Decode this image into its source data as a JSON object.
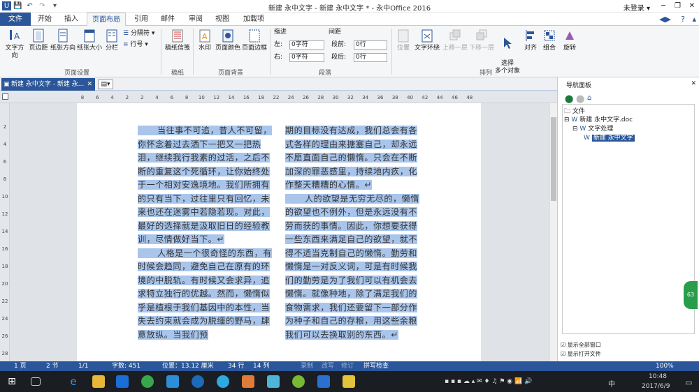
{
  "titlebar": {
    "title": "新建 永中文字 - 新建 永中文字 * - 永中Office 2016",
    "login": "未登录 ▾",
    "min": "─",
    "restore": "❐",
    "close": "✕"
  },
  "tabs": [
    {
      "label": "文件"
    },
    {
      "label": "开始"
    },
    {
      "label": "插入"
    },
    {
      "label": "页面布局"
    },
    {
      "label": "引用"
    },
    {
      "label": "邮件"
    },
    {
      "label": "审阅"
    },
    {
      "label": "视图"
    },
    {
      "label": "加载项"
    }
  ],
  "ribbon": {
    "page_setup": {
      "text_direction": "文字方向",
      "margins": "页边距",
      "orientation": "纸张方向",
      "size": "纸张大小",
      "columns": "分栏",
      "breaks": "分隔符 ▾",
      "line_numbers": "行号 ▾",
      "group": "页面设置"
    },
    "paper": {
      "manuscript": "稿纸信笺",
      "group": "稿纸"
    },
    "background": {
      "watermark": "水印",
      "page_color": "页面颜色",
      "page_border": "页面边框",
      "group": "页面背景"
    },
    "paragraph": {
      "indent": "缩进",
      "spacing": "间距",
      "left_label": "左:",
      "left_value": "0字符",
      "right_label": "右:",
      "right_value": "0字符",
      "before_label": "段前:",
      "before_value": "0行",
      "after_label": "段后:",
      "after_value": "0行",
      "group": "段落"
    },
    "arrange": {
      "position": "位置",
      "wrap": "文字环绕",
      "bring_forward": "上移一层",
      "send_backward": "下移一层",
      "select_objects": "选择\n多个对象",
      "align": "对齐",
      "group_btn": "组合",
      "rotate": "旋转",
      "group": "排列"
    }
  },
  "doctab": {
    "label": "新建 永中文字 - 新建 永...",
    "close": "✕"
  },
  "ruler": {
    "ticks": [
      "8",
      "6",
      "4",
      "2",
      "2",
      "4",
      "6",
      "8",
      "10",
      "12",
      "14",
      "16",
      "18",
      "22",
      "24",
      "26",
      "28",
      "30",
      "32",
      "34",
      "36",
      "38",
      "40",
      "42",
      "44",
      "46",
      "48"
    ]
  },
  "vruler": {
    "ticks": [
      "2",
      "4",
      "6",
      "8",
      "10",
      "12",
      "14",
      "16",
      "18",
      "20",
      "22",
      "24",
      "26",
      "28"
    ]
  },
  "document": {
    "col1": [
      "当往事不可追，昔人不可留，你怀念着过去洒下一把又一把热泪，继续我行我素的过活，之后不断的重复这个死循环，让你始终处于一个相对安逸境地。我们所拥有的只有当下，过往里只有回忆，未来也还在迷雾中若隐若现。对此，最好的选择就是汲取旧日的经验教训，尽情做好当下。↵",
      "人格是一个很奇怪的东西，有时候会趋同，避免自己在原有的环境的中脱轨。有时候又会求异，追求特立独行的优越。然而，懒惰似乎是植根于我们基因中的本性，当失去约束就会成为脱缰的野马，肆意放纵。当我们预"
    ],
    "col2": [
      "期的目标没有达成，我们总会有各式各样的理由来搪塞自己，却永远不愿直面自己的懒惰。只会在不断加深的罪恶感里，持续地内疚，化作整天糟糟的心情。↵",
      "人的欲望是无穷无尽的，懒惰的欲望也不例外，但是永远没有不劳而获的事情。因此，你想要获得一些东西来满足自己的欲望，就不得不适当克制自己的懒惰。勤劳和懒惰是一对反义词，可是有时候我们的勤劳是为了我们可以有机会去懒惰。就像种地，除了满足我们的食物需求，我们还要留下一部分作为种子和自己的存粮，用这些余粮我们可以去换取别的东西。↵"
    ]
  },
  "nav": {
    "title": "导航面板",
    "root": "文件",
    "doc": "新建 永中文字.doc",
    "proc": "文字处理",
    "item": "新建 永中文字",
    "opt1": "显示全部窗口",
    "opt2": "显示打开文件"
  },
  "status": {
    "page": "1 页",
    "section": "2 节",
    "pages": "1/1",
    "words": "字数: 451",
    "position": "位置：13.12 厘米",
    "line": "34 行",
    "col": "14 列",
    "rec": "录制",
    "rev": "改写",
    "track": "修订",
    "spell": "拼写检查",
    "zoom": "100%"
  },
  "taskbar": {
    "time": "10:48",
    "date": "2017/6/9",
    "ime": "中",
    "badge": "63"
  }
}
